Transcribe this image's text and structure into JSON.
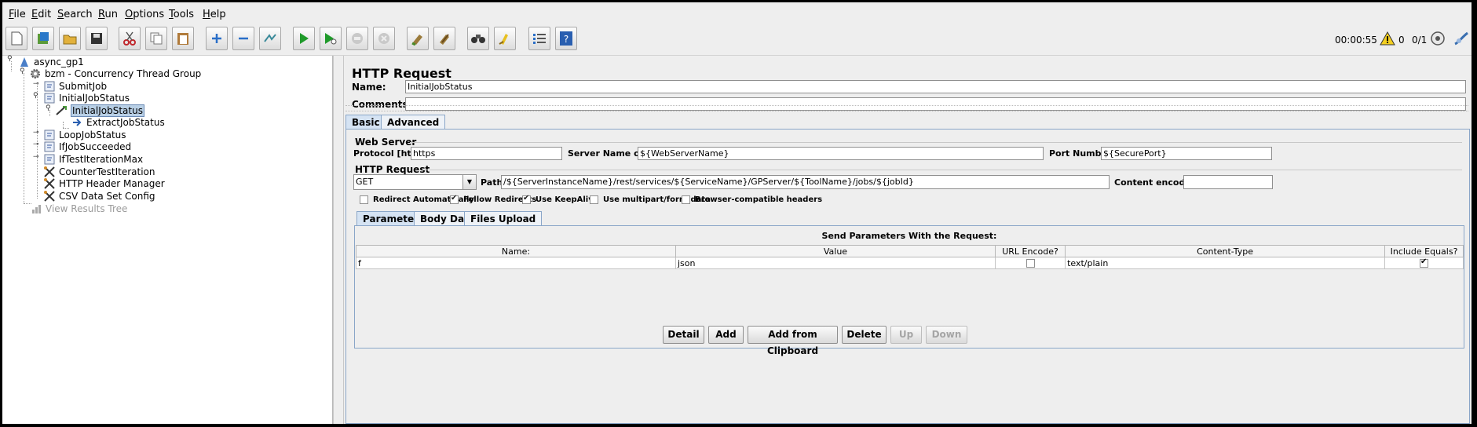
{
  "menu": [
    "File",
    "Edit",
    "Search",
    "Run",
    "Options",
    "Tools",
    "Help"
  ],
  "toolbar": {
    "icons": [
      "new-icon",
      "templates-icon",
      "open-icon",
      "save-icon",
      "cut-icon",
      "copy-icon",
      "paste-icon",
      "expand-icon",
      "collapse-icon",
      "toggle-icon",
      "start-icon",
      "start-no-pauses-icon",
      "stop-icon",
      "shutdown-icon",
      "clear-icon",
      "clear-all-icon",
      "search-icon",
      "reset-search-icon",
      "function-helper-icon",
      "help-icon"
    ],
    "elapsed": "00:00:55",
    "warning_count": "0",
    "threads": "0/1"
  },
  "tree": {
    "items": [
      {
        "label": "async_gp1",
        "type": "testplan"
      },
      {
        "label": "bzm - Concurrency Thread Group",
        "type": "threadgroup"
      },
      {
        "label": "SubmitJob",
        "type": "controller"
      },
      {
        "label": "InitialJobStatus",
        "type": "controller"
      },
      {
        "label": "InitialJobStatus",
        "type": "sampler"
      },
      {
        "label": "ExtractJobStatus",
        "type": "postprocessor"
      },
      {
        "label": "LoopJobStatus",
        "type": "controller"
      },
      {
        "label": "IfJobSucceeded",
        "type": "controller"
      },
      {
        "label": "IfTestIterationMax",
        "type": "controller"
      },
      {
        "label": "CounterTestIteration",
        "type": "config"
      },
      {
        "label": "HTTP Header Manager",
        "type": "config"
      },
      {
        "label": "CSV Data Set Config",
        "type": "config"
      },
      {
        "label": "View Results Tree",
        "type": "listener"
      }
    ]
  },
  "panel": {
    "title": "HTTP Request",
    "name_label": "Name:",
    "name_value": "InitialJobStatus",
    "comments_label": "Comments:",
    "comments_value": "",
    "tabs": [
      "Basic",
      "Advanced"
    ],
    "web_server": {
      "title": "Web Server",
      "protocol_label": "Protocol [http]:",
      "protocol_value": "https",
      "server_label": "Server Name or IP:",
      "server_value": "${WebServerName}",
      "port_label": "Port Number:",
      "port_value": "${SecurePort}"
    },
    "http_request": {
      "title": "HTTP Request",
      "method": "GET",
      "path_label": "Path:",
      "path_value": "/${ServerInstanceName}/rest/services/${ServiceName}/GPServer/${ToolName}/jobs/${jobId}",
      "encoding_label": "Content encoding:",
      "encoding_value": "",
      "options": [
        {
          "label": "Redirect Automatically",
          "checked": false
        },
        {
          "label": "Follow Redirects",
          "checked": true
        },
        {
          "label": "Use KeepAlive",
          "checked": true
        },
        {
          "label": "Use multipart/form-data",
          "checked": false
        },
        {
          "label": "Browser-compatible headers",
          "checked": false
        }
      ]
    },
    "subtabs": [
      "Parameters",
      "Body Data",
      "Files Upload"
    ],
    "params": {
      "heading": "Send Parameters With the Request:",
      "columns": [
        "Name:",
        "Value",
        "URL Encode?",
        "Content-Type",
        "Include Equals?"
      ],
      "rows": [
        {
          "name": "f",
          "value": "json",
          "url_encode": false,
          "content_type": "text/plain",
          "include_equals": true
        }
      ]
    },
    "buttons": {
      "detail": "Detail",
      "add": "Add",
      "add_clipboard": "Add from Clipboard",
      "delete": "Delete",
      "up": "Up",
      "down": "Down"
    }
  }
}
